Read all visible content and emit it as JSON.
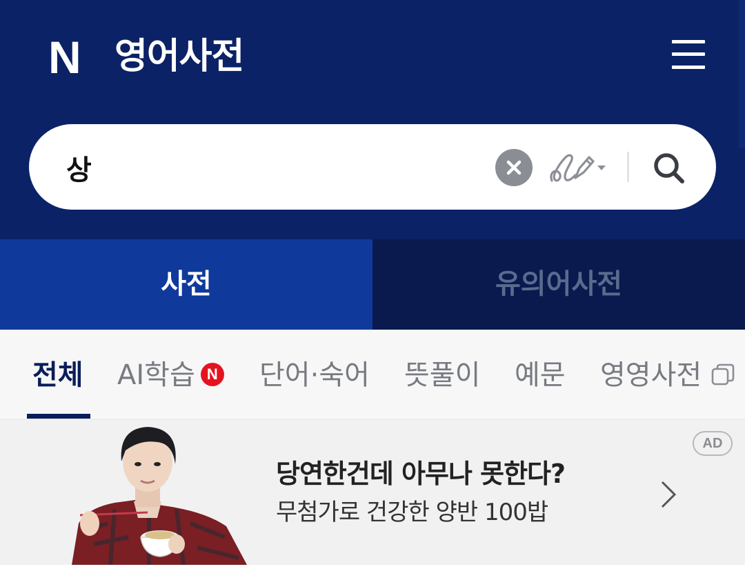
{
  "header": {
    "logo": "N",
    "title": "영어사전",
    "menu_icon": "hamburger-icon"
  },
  "search": {
    "value": "상",
    "clear_icon": "close-icon",
    "handwrite_icon": "handwriting-icon",
    "search_icon": "search-icon"
  },
  "tabs": [
    {
      "label": "사전",
      "active": true
    },
    {
      "label": "유의어사전",
      "active": false
    }
  ],
  "subnav": {
    "items": [
      {
        "label": "전체",
        "active": true
      },
      {
        "label": "AI학습",
        "badge": "N"
      },
      {
        "label": "단어·숙어"
      },
      {
        "label": "뜻풀이"
      },
      {
        "label": "예문"
      },
      {
        "label": "영영사전",
        "icon": "external-window-icon"
      }
    ]
  },
  "ad": {
    "badge": "AD",
    "headline": "당연한건데 아무나 못한다?",
    "subtext": "무첨가로 건강한 양반 100밥",
    "arrow_icon": "chevron-right-icon"
  },
  "colors": {
    "header_bg": "#0b2266",
    "tab_active_bg": "#0f3a9c",
    "tab_inactive_bg": "#0a1a4e",
    "badge_red": "#e5131f",
    "active_text": "#0b1d5a"
  }
}
